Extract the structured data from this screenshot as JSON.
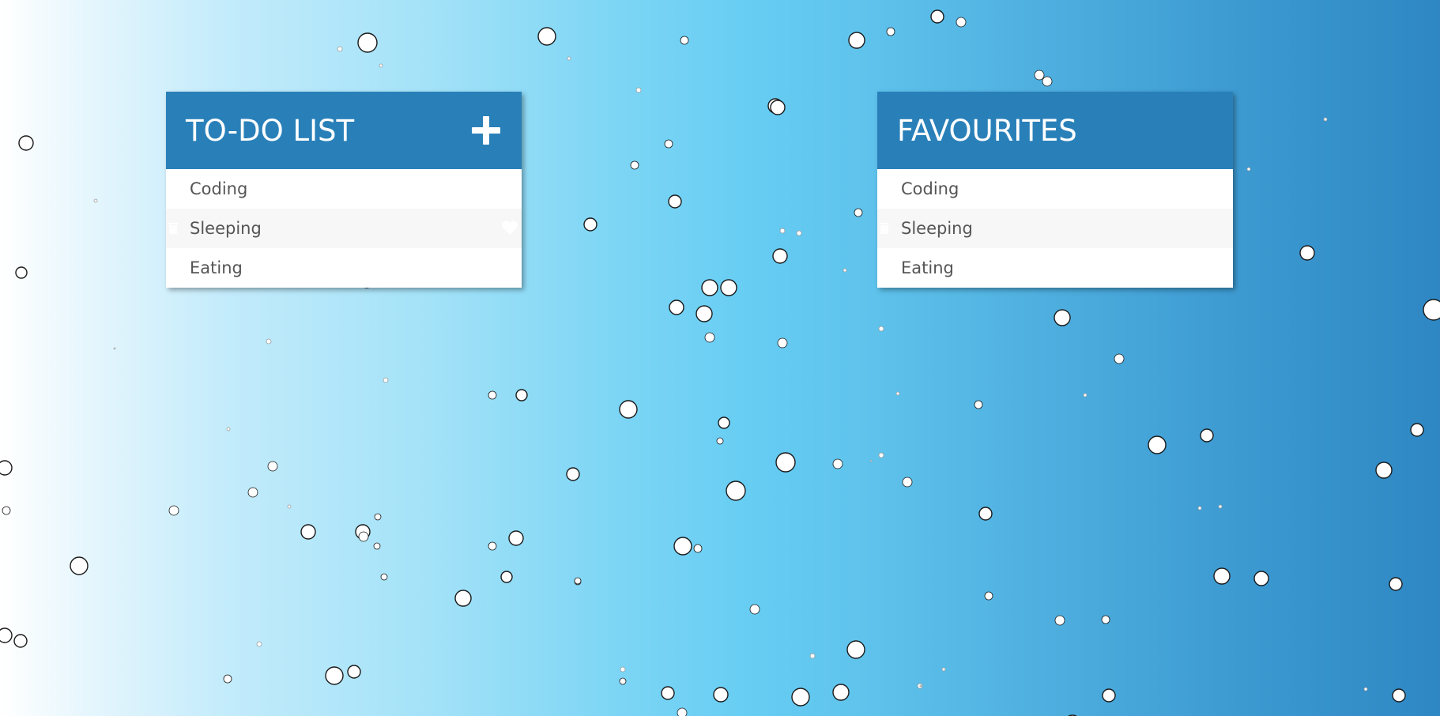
{
  "todo": {
    "title": "TO-DO LIST",
    "add_icon": "plus-icon",
    "items": [
      {
        "label": "Coding"
      },
      {
        "label": "Sleeping"
      },
      {
        "label": "Eating"
      }
    ]
  },
  "favourites": {
    "title": "FAVOURITES",
    "items": [
      {
        "label": "Coding"
      },
      {
        "label": "Sleeping"
      },
      {
        "label": "Eating"
      }
    ]
  },
  "colors": {
    "header": "#2980b9",
    "item_text": "#555555",
    "alt_row": "#f7f7f7"
  },
  "icons": [
    "plus-icon",
    "trash-icon",
    "heart-icon"
  ]
}
